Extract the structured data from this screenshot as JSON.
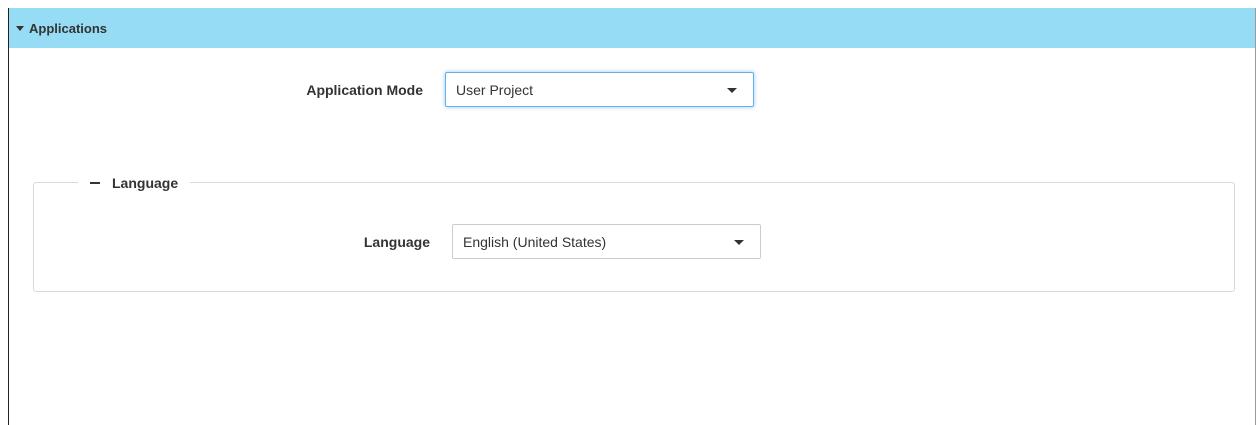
{
  "panel": {
    "title": "Applications"
  },
  "application_mode": {
    "label": "Application Mode",
    "selected": "User Project"
  },
  "language_section": {
    "legend": "Language",
    "language": {
      "label": "Language",
      "selected": "English (United States)"
    }
  },
  "colors": {
    "header_background": "#96dcf4",
    "focus_border": "#66afe9"
  }
}
